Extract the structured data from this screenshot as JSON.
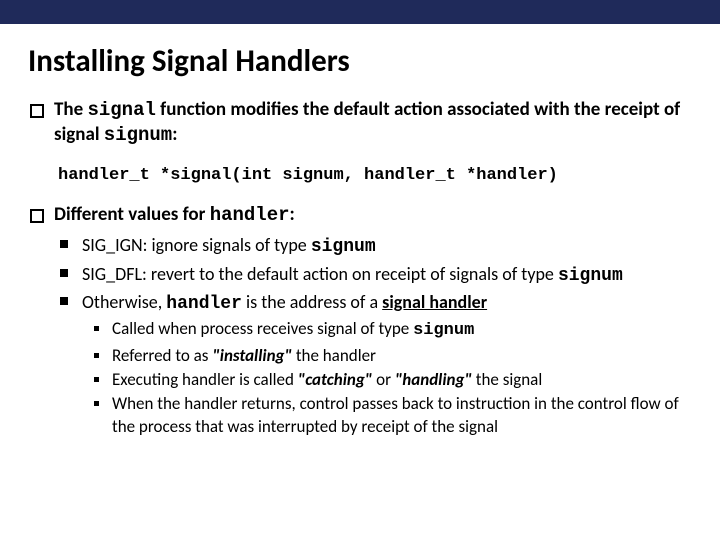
{
  "title": "Installing Signal Handlers",
  "p1_a": "The ",
  "p1_b": "signal",
  "p1_c": " function modifies the default action associated with the receipt of signal ",
  "p1_d": "signum",
  "p1_e": ":",
  "proto": "handler_t *signal(int signum, handler_t *handler)",
  "p2_a": "Different values for ",
  "p2_b": "handler",
  "p2_c": ":",
  "s1_a": "SIG_IGN: ignore signals of type ",
  "s1_b": "signum",
  "s2_a": "SIG_DFL: revert to the default action on receipt of signals of type ",
  "s2_b": "signum",
  "s3_a": "Otherwise, ",
  "s3_b": "handler",
  "s3_c": " is the address of a ",
  "s3_d": "signal handler",
  "d1_a": "Called when process receives signal of type ",
  "d1_b": "signum",
  "d2_a": "Referred to as ",
  "d2_b": "\"installing\"",
  "d2_c": " the handler",
  "d3_a": "Executing handler is called ",
  "d3_b": "\"catching\"",
  "d3_c": " or ",
  "d3_d": "\"handling\"",
  "d3_e": " the signal",
  "d4": "When the handler returns, control passes back to instruction in the control flow of the process that was interrupted by receipt of the signal"
}
